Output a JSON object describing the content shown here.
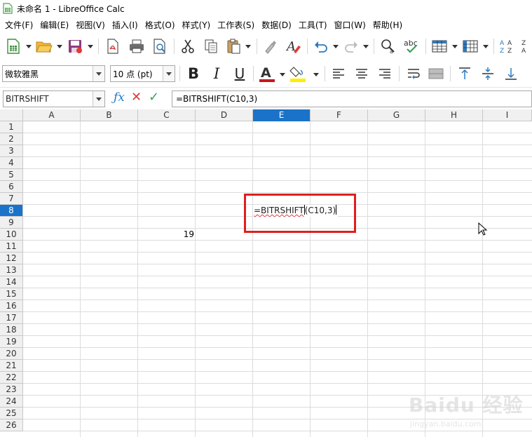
{
  "window": {
    "title": "未命名 1 - LibreOffice Calc"
  },
  "menu": [
    "文件(F)",
    "编辑(E)",
    "视图(V)",
    "插入(I)",
    "格式(O)",
    "样式(Y)",
    "工作表(S)",
    "数据(D)",
    "工具(T)",
    "窗口(W)",
    "帮助(H)"
  ],
  "format_toolbar": {
    "font_name": "微软雅黑",
    "font_size": "10 点 (pt)",
    "bold_label": "B",
    "italic_label": "I",
    "underline_label": "U",
    "font_color_label": "A"
  },
  "formula_bar": {
    "name_box": "BITRSHIFT",
    "formula": "=BITRSHIFT(C10,3)"
  },
  "columns": [
    "A",
    "B",
    "C",
    "D",
    "E",
    "F",
    "G",
    "H",
    "I"
  ],
  "active_column": "E",
  "rows": [
    "1",
    "2",
    "3",
    "4",
    "5",
    "6",
    "7",
    "8",
    "9",
    "10",
    "11",
    "12",
    "13",
    "14",
    "15",
    "16",
    "17",
    "18",
    "19",
    "20",
    "21",
    "22",
    "23",
    "24",
    "25",
    "26"
  ],
  "active_row": "8",
  "cells": {
    "C10": "19",
    "E8_prefix": "=BITRSHIFT",
    "E8_args": "(C10,3)"
  },
  "watermark": {
    "brand": "Baidu 经验",
    "url": "jingyan.baidu.com"
  },
  "colors": {
    "accent": "#1a73c8",
    "highlight_box": "#e01e1e",
    "cancel": "#d93b3b",
    "accept": "#3ea055"
  }
}
